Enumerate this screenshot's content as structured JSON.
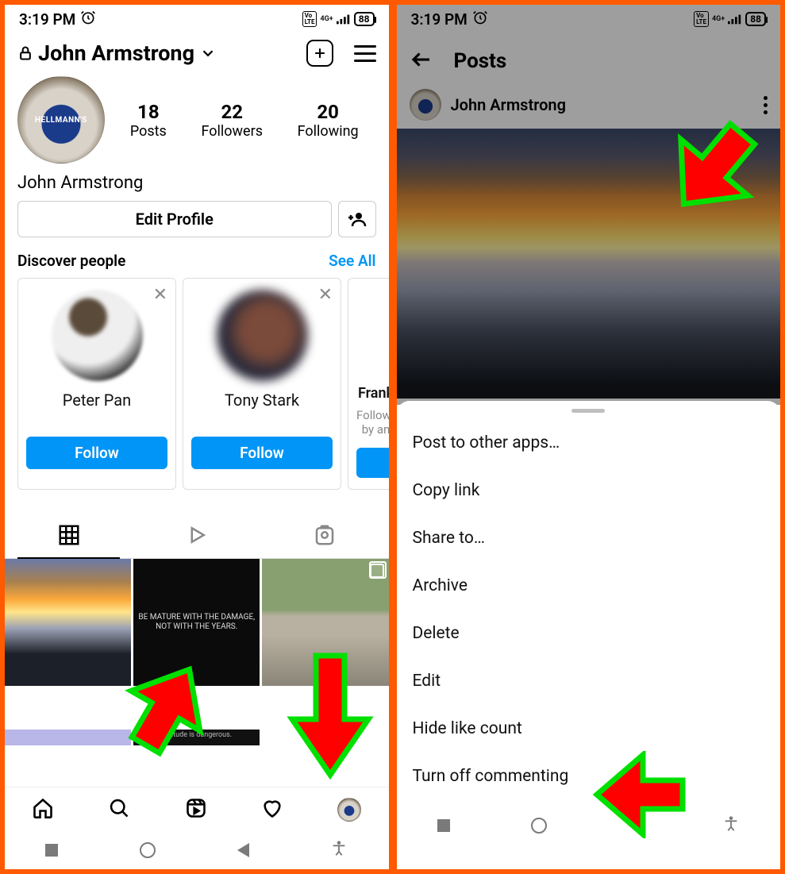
{
  "status": {
    "time": "3:19 PM",
    "lte_label": "Vo\nLTE",
    "net_label": "4G+",
    "battery": "88"
  },
  "left": {
    "header": {
      "username": "John Armstrong"
    },
    "stats": {
      "posts_count": "18",
      "posts_label": "Posts",
      "followers_count": "22",
      "followers_label": "Followers",
      "following_count": "20",
      "following_label": "Following"
    },
    "display_name": "John Armstrong",
    "edit_profile_label": "Edit Profile",
    "discover_label": "Discover people",
    "see_all_label": "See All",
    "cards": [
      {
        "name": "Peter Pan",
        "sub": "",
        "follow": "Follow"
      },
      {
        "name": "Tony Stark",
        "sub": "",
        "follow": "Follow"
      },
      {
        "name": "Frank",
        "sub": "Followed by an",
        "follow": ""
      }
    ],
    "quote1": "BE MATURE WITH THE DAMAGE, NOT WITH THE YEARS.",
    "quote2": "Solitude is dangerous."
  },
  "right": {
    "title": "Posts",
    "author": "John Armstrong",
    "sheet": [
      "Post to other apps…",
      "Copy link",
      "Share to…",
      "Archive",
      "Delete",
      "Edit",
      "Hide like count",
      "Turn off commenting"
    ]
  }
}
